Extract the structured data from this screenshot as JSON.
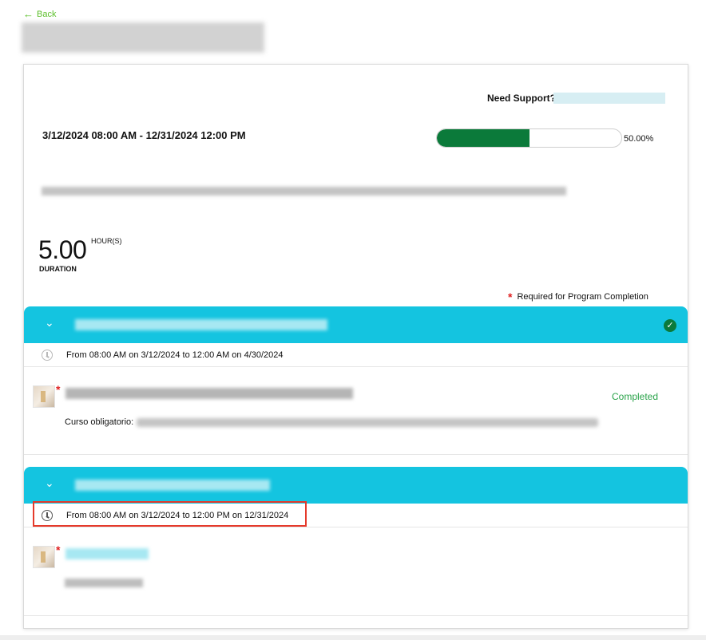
{
  "nav": {
    "back_label": "Back",
    "back_arrow": "←"
  },
  "program": {
    "date_range": "3/12/2024 08:00 AM - 12/31/2024 12:00 PM",
    "support_label": "Need Support?",
    "progress_percent": 50,
    "progress_text": "50.00%",
    "duration_value": "5.00",
    "duration_unit": "HOUR(S)",
    "duration_label": "DURATION",
    "required_star": "*",
    "required_note": "Required for Program Completion"
  },
  "sections": [
    {
      "chevron": "⌄",
      "time_text": "From 08:00 AM on 3/12/2024 to 12:00 AM on 4/30/2024",
      "status_icon": "check-icon",
      "item": {
        "star": "*",
        "status": "Completed",
        "desc_prefix": "Curso obligatorio:"
      }
    },
    {
      "chevron": "⌄",
      "time_text": "From 08:00 AM on 3/12/2024 to 12:00 PM on 12/31/2024",
      "item": {
        "star": "*"
      }
    }
  ],
  "colors": {
    "accent_cyan": "#14c4e0",
    "progress_green": "#0b7a3a",
    "back_green": "#5bbf2a",
    "completed_green": "#2aa34a",
    "required_red": "#e02020",
    "highlight_red": "#e53a2b"
  }
}
